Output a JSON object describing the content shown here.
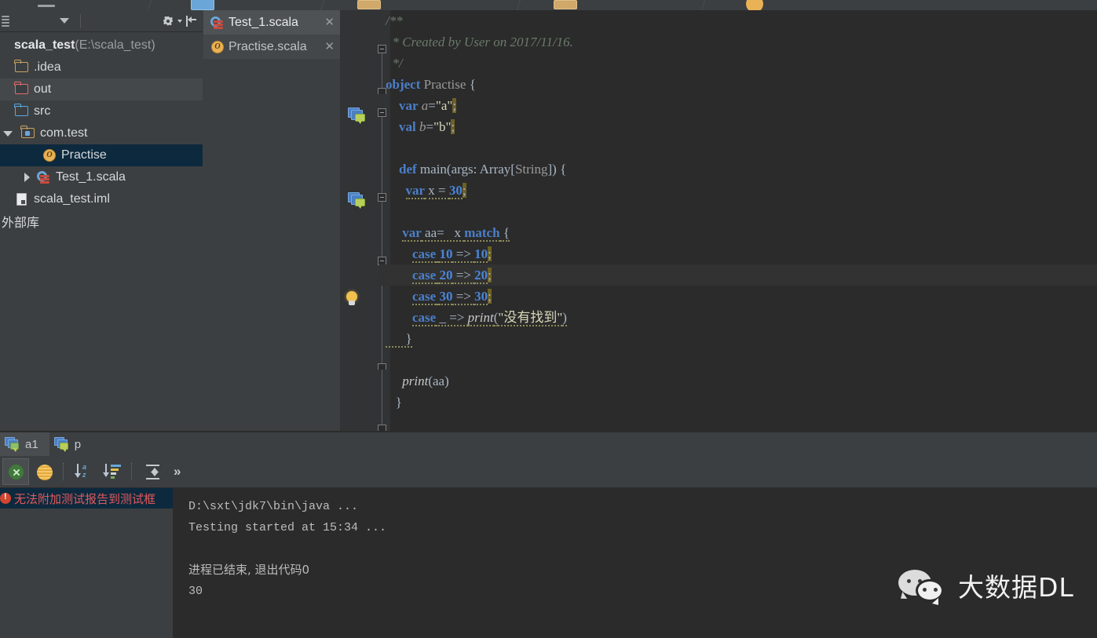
{
  "toolbar": {
    "icons": [
      "minimize-icon",
      "blue-rect-icon",
      "tan-rect-icon",
      "tan-rect-icon-2",
      "orange-circle-icon"
    ]
  },
  "project_panel": {
    "header": {
      "grip_icon": "grip-icon",
      "dropdown_icon": "chevron-down-icon",
      "settings_icon": "gear-icon",
      "settings_caret_icon": "chevron-down-small-icon",
      "hide_icon": "hide-panel-icon"
    },
    "tree": [
      {
        "label": "scala_test",
        "path_suffix": " (E:\\scala_test)",
        "icon": "project-root-icon",
        "indent": 0,
        "state": "root"
      },
      {
        "label": ".idea",
        "icon": "folder-icon",
        "indent": 1,
        "twisty": "none"
      },
      {
        "label": "out",
        "icon": "folder-red-icon",
        "indent": 1,
        "twisty": "none",
        "highlight": true
      },
      {
        "label": "src",
        "icon": "folder-blue-icon",
        "indent": 1,
        "twisty": "none"
      },
      {
        "label": "com.test",
        "icon": "package-folder-icon",
        "indent": 1,
        "twisty": "down"
      },
      {
        "label": "Practise",
        "icon": "scala-object-icon",
        "indent": 2,
        "twisty": "none",
        "selected": true
      },
      {
        "label": "Test_1.scala",
        "icon": "scala-file-icon",
        "indent": 2,
        "twisty": "right"
      },
      {
        "label": "scala_test.iml",
        "icon": "iml-file-icon",
        "indent": 0,
        "twisty": "none"
      },
      {
        "label": "外部库",
        "icon": "none",
        "indent": 0,
        "twisty": "none"
      }
    ]
  },
  "editor_tabs": [
    {
      "label": "Test_1.scala",
      "icon": "scala-file-icon",
      "active": true,
      "close_icon": "close-icon"
    },
    {
      "label": "Practise.scala",
      "icon": "scala-object-icon",
      "active": false,
      "close_icon": "close-icon"
    }
  ],
  "editor": {
    "lines": [
      {
        "id": "l1",
        "fold": "open-start",
        "tokens": [
          {
            "t": "comment",
            "v": "/**"
          }
        ]
      },
      {
        "id": "l2",
        "tokens": [
          {
            "t": "comment",
            "v": "  * Created by User on 2017/11/16."
          }
        ]
      },
      {
        "id": "l3",
        "fold": "end",
        "tokens": [
          {
            "t": "comment",
            "v": "  */"
          }
        ]
      },
      {
        "id": "l4",
        "fold": "open-start",
        "gutter": "scala-object-marker-icon",
        "tokens": [
          {
            "t": "kw",
            "v": "object"
          },
          {
            "t": "plain",
            "v": " "
          },
          {
            "t": "type",
            "v": "Practise"
          },
          {
            "t": "plain",
            "v": " {"
          }
        ]
      },
      {
        "id": "l5",
        "tokens": [
          {
            "t": "plain",
            "v": "    "
          },
          {
            "t": "kw",
            "v": "var"
          },
          {
            "t": "plain",
            "v": " "
          },
          {
            "t": "ident",
            "v": "a"
          },
          {
            "t": "plain",
            "v": "="
          },
          {
            "t": "string",
            "v": "\"a\""
          },
          {
            "t": "warn",
            "v": ";"
          }
        ]
      },
      {
        "id": "l6",
        "tokens": [
          {
            "t": "plain",
            "v": "    "
          },
          {
            "t": "kw",
            "v": "val"
          },
          {
            "t": "plain",
            "v": " "
          },
          {
            "t": "ident",
            "v": "b"
          },
          {
            "t": "plain",
            "v": "="
          },
          {
            "t": "string",
            "v": "\"b\""
          },
          {
            "t": "warn",
            "v": ";"
          }
        ]
      },
      {
        "id": "l7",
        "tokens": []
      },
      {
        "id": "l8",
        "fold": "open-start",
        "gutter": "scala-method-marker-icon",
        "tokens": [
          {
            "t": "plain",
            "v": "    "
          },
          {
            "t": "kw",
            "v": "def"
          },
          {
            "t": "plain",
            "v": " "
          },
          {
            "t": "fn",
            "v": "main"
          },
          {
            "t": "plain",
            "v": "(args: Array["
          },
          {
            "t": "type",
            "v": "String"
          },
          {
            "t": "plain",
            "v": "]) {"
          }
        ]
      },
      {
        "id": "l9",
        "tokens": [
          {
            "t": "plain",
            "v": "      "
          },
          {
            "t": "kw-u",
            "v": "var"
          },
          {
            "t": "plain-u",
            "v": " x = "
          },
          {
            "t": "num",
            "v": "30"
          },
          {
            "t": "warn",
            "v": ";"
          }
        ]
      },
      {
        "id": "l10",
        "tokens": []
      },
      {
        "id": "l11",
        "fold": "open-start",
        "tokens": [
          {
            "t": "plain",
            "v": "     "
          },
          {
            "t": "kw-u",
            "v": "var"
          },
          {
            "t": "plain-u",
            "v": " aa=   x "
          },
          {
            "t": "kw-u",
            "v": "match"
          },
          {
            "t": "plain-u",
            "v": " {"
          }
        ]
      },
      {
        "id": "l12",
        "tokens": [
          {
            "t": "plain",
            "v": "        "
          },
          {
            "t": "kw-u",
            "v": "case"
          },
          {
            "t": "plain-u",
            "v": " "
          },
          {
            "t": "num-u",
            "v": "10"
          },
          {
            "t": "plain-u",
            "v": " => "
          },
          {
            "t": "num-u",
            "v": "10"
          },
          {
            "t": "warn",
            "v": ";"
          }
        ]
      },
      {
        "id": "l13",
        "caret": true,
        "gutter": "lightbulb-icon",
        "tokens": [
          {
            "t": "plain",
            "v": "        "
          },
          {
            "t": "kw-u",
            "v": "case"
          },
          {
            "t": "plain-u",
            "v": " "
          },
          {
            "t": "num-u",
            "v": "20"
          },
          {
            "t": "plain-u",
            "v": " => "
          },
          {
            "t": "num-u",
            "v": "20"
          },
          {
            "t": "warn",
            "v": ";"
          }
        ]
      },
      {
        "id": "l14",
        "tokens": [
          {
            "t": "plain",
            "v": "        "
          },
          {
            "t": "kw-u",
            "v": "case"
          },
          {
            "t": "plain-u",
            "v": " "
          },
          {
            "t": "num-u",
            "v": "30"
          },
          {
            "t": "plain-u",
            "v": " => "
          },
          {
            "t": "num-u",
            "v": "30"
          },
          {
            "t": "warn",
            "v": ";"
          }
        ]
      },
      {
        "id": "l15",
        "tokens": [
          {
            "t": "plain",
            "v": "        "
          },
          {
            "t": "kw-u",
            "v": "case"
          },
          {
            "t": "plain-u",
            "v": " _ => "
          },
          {
            "t": "fn-u",
            "v": "print"
          },
          {
            "t": "plain-u",
            "v": "("
          },
          {
            "t": "string-u",
            "v": "\"没有找到\""
          },
          {
            "t": "plain-u",
            "v": ")"
          }
        ]
      },
      {
        "id": "l16",
        "fold": "end",
        "tokens": [
          {
            "t": "plain-u",
            "v": "      }"
          }
        ]
      },
      {
        "id": "l17",
        "tokens": []
      },
      {
        "id": "l18",
        "tokens": [
          {
            "t": "plain",
            "v": "     "
          },
          {
            "t": "fn",
            "v": "print"
          },
          {
            "t": "plain",
            "v": "(aa)"
          }
        ]
      },
      {
        "id": "l19",
        "fold": "end",
        "tokens": [
          {
            "t": "plain",
            "v": "   }"
          }
        ]
      }
    ]
  },
  "bottom_tabs": [
    {
      "label": "a1",
      "icon": "test-run-tab-icon",
      "active": true
    },
    {
      "label": "p",
      "icon": "run-tab-icon",
      "active": false
    }
  ],
  "run_toolbar": {
    "buttons": [
      {
        "name": "hide-passed-icon",
        "icon": "green-x-icon",
        "boxed": true
      },
      {
        "name": "show-ignored-icon",
        "icon": "sun-icon",
        "boxed": false
      },
      {
        "name": "sort-alphabetically-icon",
        "icon": "sort-az-icon",
        "boxed": false,
        "az_top": "a",
        "az_bottom": "z"
      },
      {
        "name": "sort-by-duration-icon",
        "icon": "sort-lines-icon",
        "boxed": false
      },
      {
        "name": "expand-collapse-icon",
        "icon": "collapse-all-icon",
        "boxed": false
      },
      {
        "name": "more-options-icon",
        "icon": "chevron-right-double-icon",
        "boxed": false,
        "glyph": "»"
      }
    ]
  },
  "test_tree": {
    "rows": [
      {
        "label": "无法附加测试报告到测试框",
        "icon": "error-icon",
        "selected": true
      }
    ]
  },
  "console": {
    "lines": [
      {
        "text": "D:\\sxt\\jdk7\\bin\\java ...",
        "style": "command"
      },
      {
        "text": "Testing started at 15:34 ...",
        "style": "normal"
      },
      {
        "text": "",
        "style": "normal"
      },
      {
        "text": "进程已结束, 退出代码0",
        "style": "zh"
      },
      {
        "text": "30",
        "style": "normal"
      }
    ]
  },
  "watermark": {
    "text": "大数据DL",
    "logo_icon": "wechat-icon"
  },
  "colors": {
    "editor_bg": "#2b2b2b",
    "panel_bg": "#3c3f41",
    "selection_blue": "#0d293e",
    "keyword_orange": "#cc7832",
    "keyword_blue": "#4b7fc9",
    "number_blue": "#4a86d8",
    "string_olive": "#d7d7ba",
    "comment_green": "#6a7a6a",
    "warn_bg": "#6e6024",
    "error_red": "#e05a5a"
  }
}
